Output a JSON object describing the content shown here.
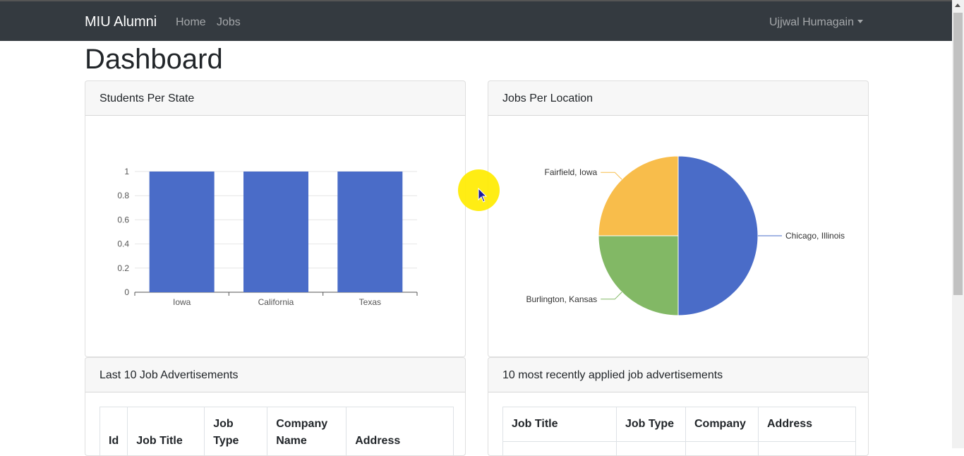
{
  "navbar": {
    "brand": "MIU Alumni",
    "links": [
      "Home",
      "Jobs"
    ],
    "user": "Ujjwal Humagain"
  },
  "page": {
    "title": "Dashboard"
  },
  "cards": {
    "students_per_state": {
      "title": "Students Per State"
    },
    "jobs_per_location": {
      "title": "Jobs Per Location"
    },
    "last_jobs": {
      "title": "Last 10 Job Advertisements",
      "columns": [
        "Id",
        "Job Title",
        "Job Type",
        "Company Name",
        "Address"
      ]
    },
    "recent_applied": {
      "title": "10 most recently applied job advertisements",
      "columns": [
        "Job Title",
        "Job Type",
        "Company",
        "Address"
      ]
    }
  },
  "colors": {
    "navbar": "#343a40",
    "blue": "#4a6cc8",
    "yellow": "#f8bd4b",
    "green": "#82b865"
  },
  "chart_data": [
    {
      "type": "bar",
      "categories": [
        "Iowa",
        "California",
        "Texas"
      ],
      "values": [
        1,
        1,
        1
      ],
      "yticks": [
        "0",
        "0.2",
        "0.4",
        "0.6",
        "0.8",
        "1"
      ],
      "ylim": [
        0,
        1
      ],
      "grid": true
    },
    {
      "type": "pie",
      "labels": [
        "Chicago, Illinois",
        "Burlington, Kansas",
        "Fairfield, Iowa"
      ],
      "values": [
        2,
        1,
        1
      ]
    }
  ]
}
